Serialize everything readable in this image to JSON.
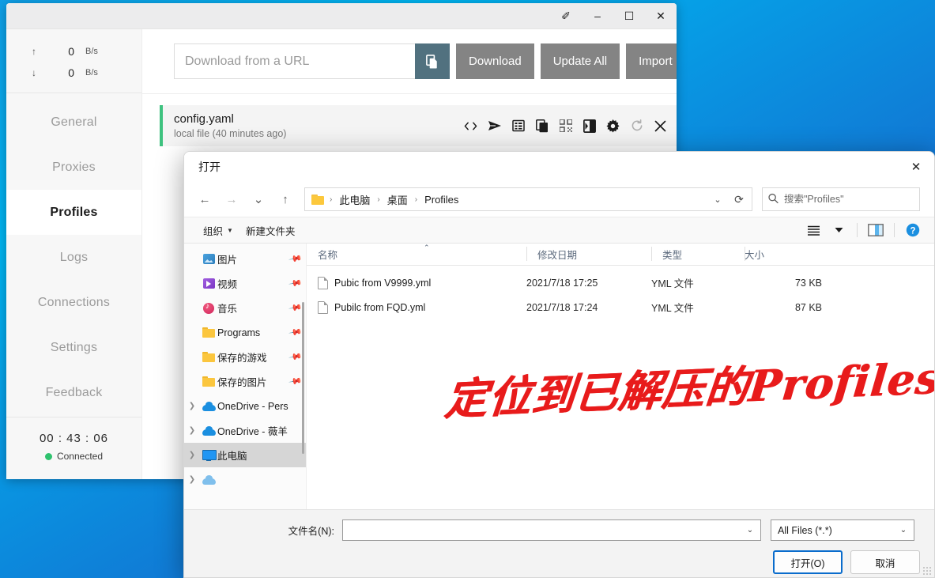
{
  "desktop": {
    "background_top": "#00b4f0",
    "background_bottom": "#0a5fc0"
  },
  "app_window": {
    "titlebar": {
      "pin_label": "✐",
      "minimize_label": "–",
      "maximize_label": "☐",
      "close_label": "✕"
    },
    "sidebar": {
      "traffic": [
        {
          "direction": "up",
          "arrow": "↑",
          "value": "0",
          "unit": "B/s"
        },
        {
          "direction": "down",
          "arrow": "↓",
          "value": "0",
          "unit": "B/s"
        }
      ],
      "nav_items": [
        {
          "label": "General",
          "active": false
        },
        {
          "label": "Proxies",
          "active": false
        },
        {
          "label": "Profiles",
          "active": true
        },
        {
          "label": "Logs",
          "active": false
        },
        {
          "label": "Connections",
          "active": false
        },
        {
          "label": "Settings",
          "active": false
        },
        {
          "label": "Feedback",
          "active": false
        }
      ],
      "uptime": "00 : 43 : 06",
      "connection_status": "Connected",
      "status_color": "#2fc26e"
    },
    "toolbar": {
      "url_placeholder": "Download from a URL",
      "url_value": "",
      "clipboard_icon": "copy-icon",
      "download_label": "Download",
      "update_all_label": "Update All",
      "import_label": "Import"
    },
    "profile_card": {
      "name": "config.yaml",
      "subtitle": "local file (40 minutes ago)",
      "accent_color": "#3ec27f",
      "actions": [
        {
          "icon": "code-brackets-icon",
          "glyph": "‹›"
        },
        {
          "icon": "send-icon",
          "glyph": "➤"
        },
        {
          "icon": "list-icon",
          "glyph": "▤"
        },
        {
          "icon": "copy-icon",
          "glyph": "❐"
        },
        {
          "icon": "qr-code-icon",
          "glyph": "⬚"
        },
        {
          "icon": "contrast-book-icon",
          "glyph": "◑"
        },
        {
          "icon": "gear-icon",
          "glyph": "⚙"
        },
        {
          "icon": "refresh-icon",
          "glyph": "⟳"
        },
        {
          "icon": "close-icon",
          "glyph": "✕"
        }
      ]
    }
  },
  "file_dialog": {
    "title": "打开",
    "close_label": "✕",
    "nav": {
      "back_icon": "arrow-left-icon",
      "forward_icon": "arrow-right-icon",
      "recent_icon": "chevron-down-icon",
      "up_icon": "arrow-up-icon",
      "back_glyph": "←",
      "forward_glyph": "→",
      "recent_glyph": "⌄",
      "up_glyph": "↑",
      "refresh_glyph": "⟳"
    },
    "breadcrumb": [
      "此电脑",
      "桌面",
      "Profiles"
    ],
    "breadcrumb_separator": "›",
    "search": {
      "placeholder": "搜索\"Profiles\"",
      "value": "",
      "icon": "search-icon"
    },
    "command_bar": {
      "organize_label": "组织",
      "new_folder_label": "新建文件夹",
      "view_icon": "view-list-icon",
      "view_caret": "▼",
      "preview_pane_icon": "preview-pane-icon",
      "help_icon": "help-icon",
      "help_glyph": "?"
    },
    "tree": [
      {
        "label": "图片",
        "icon": "pictures-icon",
        "pinned": true,
        "expandable": false,
        "selected": false
      },
      {
        "label": "视频",
        "icon": "videos-icon",
        "pinned": true,
        "expandable": false,
        "selected": false
      },
      {
        "label": "音乐",
        "icon": "music-icon",
        "pinned": true,
        "expandable": false,
        "selected": false
      },
      {
        "label": "Programs",
        "icon": "folder-icon",
        "pinned": true,
        "expandable": false,
        "selected": false
      },
      {
        "label": "保存的游戏",
        "icon": "folder-icon",
        "pinned": true,
        "expandable": false,
        "selected": false
      },
      {
        "label": "保存的图片",
        "icon": "folder-icon",
        "pinned": true,
        "expandable": false,
        "selected": false
      },
      {
        "label": "OneDrive - Pers",
        "icon": "onedrive-icon",
        "pinned": false,
        "expandable": true,
        "selected": false
      },
      {
        "label": "OneDrive - 薇羊",
        "icon": "onedrive-icon",
        "pinned": false,
        "expandable": true,
        "selected": false
      },
      {
        "label": "此电脑",
        "icon": "this-pc-icon",
        "pinned": false,
        "expandable": true,
        "selected": true
      }
    ],
    "columns": [
      {
        "key": "name",
        "label": "名称",
        "sorted": true,
        "sort_caret": "⌃"
      },
      {
        "key": "date",
        "label": "修改日期",
        "sorted": false
      },
      {
        "key": "type",
        "label": "类型",
        "sorted": false
      },
      {
        "key": "size",
        "label": "大小",
        "sorted": false
      }
    ],
    "files": [
      {
        "name": "Pubic from V9999.yml",
        "date": "2021/7/18 17:25",
        "type": "YML 文件",
        "size": "73 KB"
      },
      {
        "name": "Pubilc from FQD.yml",
        "date": "2021/7/18 17:24",
        "type": "YML 文件",
        "size": "87 KB"
      }
    ],
    "annotation": {
      "text": "定位到已解压的Profiles文件夹",
      "color": "#e81b1b"
    },
    "bottom": {
      "filename_label": "文件名(N):",
      "filename_value": "",
      "filter_value": "All Files (*.*)",
      "combo_caret": "⌄",
      "open_label": "打开(O)",
      "cancel_label": "取消"
    }
  }
}
